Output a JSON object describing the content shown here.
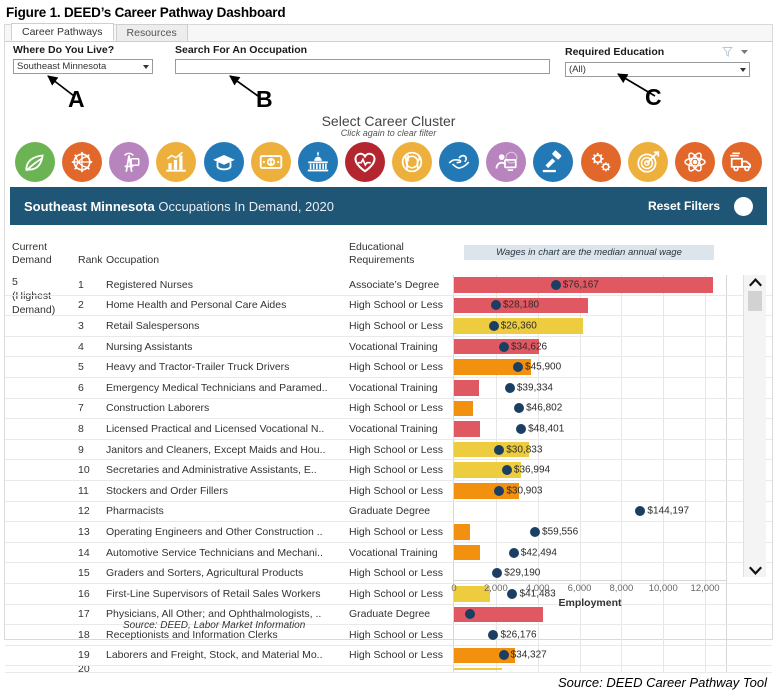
{
  "figure": {
    "caption": "Figure 1. DEED’s Career Pathway Dashboard",
    "bottom_source": "Source: DEED Career Pathway Tool"
  },
  "tabs": [
    {
      "label": "Career Pathways",
      "active": true
    },
    {
      "label": "Resources",
      "active": false
    }
  ],
  "filters": {
    "region": {
      "label": "Where Do You Live?",
      "value": "Southeast Minnesota"
    },
    "search": {
      "label": "Search For An Occupation",
      "value": "",
      "placeholder": ""
    },
    "education": {
      "label": "Required Education",
      "value": "(All)"
    }
  },
  "cluster": {
    "title": "Select Career Cluster",
    "subtitle": "Click again to clear filter",
    "icons": [
      {
        "name": "agriculture-leaf-icon",
        "color": "#6cb353",
        "glyph": "leaf"
      },
      {
        "name": "architecture-gear-icon",
        "color": "#e2672a",
        "glyph": "gear-globe"
      },
      {
        "name": "arts-communications-icon",
        "color": "#b884bd",
        "glyph": "broadcast-tower"
      },
      {
        "name": "business-chart-icon",
        "color": "#eeb03c",
        "glyph": "bar-chart"
      },
      {
        "name": "education-graduation-icon",
        "color": "#2279b5",
        "glyph": "graduation-cap"
      },
      {
        "name": "finance-money-icon",
        "color": "#eeb03c",
        "glyph": "banknote"
      },
      {
        "name": "government-capitol-icon",
        "color": "#2279b5",
        "glyph": "capitol"
      },
      {
        "name": "health-science-heart-icon",
        "color": "#b3262f",
        "glyph": "heart-pulse"
      },
      {
        "name": "hospitality-tourism-icon",
        "color": "#eeb03c",
        "glyph": "plate-utensils"
      },
      {
        "name": "human-services-hands-icon",
        "color": "#2279b5",
        "glyph": "helping-hands"
      },
      {
        "name": "information-technology-icon",
        "color": "#b884bd",
        "glyph": "person-computer"
      },
      {
        "name": "law-public-safety-gavel-icon",
        "color": "#2279b5",
        "glyph": "gavel"
      },
      {
        "name": "manufacturing-gears-icon",
        "color": "#e2672a",
        "glyph": "gears"
      },
      {
        "name": "marketing-target-icon",
        "color": "#eeb03c",
        "glyph": "target-arrow"
      },
      {
        "name": "stem-atom-icon",
        "color": "#e2672a",
        "glyph": "atom"
      },
      {
        "name": "transportation-truck-icon",
        "color": "#e2672a",
        "glyph": "delivery-truck"
      }
    ]
  },
  "banner": {
    "region": "Southeast Minnesota",
    "rest": " Occupations In Demand, 2020",
    "reset_label": "Reset Filters"
  },
  "table": {
    "headers": {
      "demand": "Current Demand",
      "rank": "Rank",
      "occupation": "Occupation",
      "education": "Educational Requirements"
    },
    "wage_note": "Wages in chart are the median annual wage",
    "demand_value": "5",
    "demand_caption_1": "(Highest",
    "demand_caption_2": "Demand)",
    "source_left": "Source: DEED, Labor Market Information"
  },
  "chart_data": {
    "type": "bar",
    "title": "Southeast Minnesota Occupations In Demand, 2020",
    "xlabel": "Employment",
    "ylabel": "",
    "xlim": [
      0,
      13000
    ],
    "grid": true,
    "ticks": [
      0,
      2000,
      4000,
      6000,
      8000,
      10000,
      12000
    ],
    "tick_labels": [
      "0",
      "2,000",
      "4,000",
      "6,000",
      "8,000",
      "10,000",
      "12,000"
    ],
    "dot_series_name": "Median annual wage",
    "dot_color": "#1b3f63",
    "bar_colors": {
      "red": "#e05862",
      "orange": "#f2900f",
      "yellow": "#edcd3f"
    },
    "rows": [
      {
        "rank": "1",
        "occupation": "Registered Nurses",
        "education": "Associate’s Degree",
        "employment": 12400,
        "wage": 76167,
        "wage_label": "$76,167",
        "color": "#e05862"
      },
      {
        "rank": "2",
        "occupation": "Home Health and Personal Care Aides",
        "education": "High School or Less",
        "employment": 6400,
        "wage": 28180,
        "wage_label": "$28,180",
        "color": "#e05862"
      },
      {
        "rank": "3",
        "occupation": "Retail Salespersons",
        "education": "High School or Less",
        "employment": 6150,
        "wage": 26360,
        "wage_label": "$26,360",
        "color": "#edcd3f"
      },
      {
        "rank": "4",
        "occupation": "Nursing Assistants",
        "education": "Vocational Training",
        "employment": 4050,
        "wage": 34626,
        "wage_label": "$34,626",
        "color": "#e05862"
      },
      {
        "rank": "5",
        "occupation": "Heavy and Tractor-Trailer Truck Drivers",
        "education": "High School or Less",
        "employment": 3700,
        "wage": 45900,
        "wage_label": "$45,900",
        "color": "#f2900f"
      },
      {
        "rank": "6",
        "occupation": "Emergency Medical Technicians and Paramed..",
        "education": "Vocational Training",
        "employment": 1200,
        "wage": 39334,
        "wage_label": "$39,334",
        "color": "#e05862"
      },
      {
        "rank": "7",
        "occupation": "Construction Laborers",
        "education": "High School or Less",
        "employment": 900,
        "wage": 46802,
        "wage_label": "$46,802",
        "color": "#f2900f"
      },
      {
        "rank": "8",
        "occupation": "Licensed Practical and Licensed Vocational N..",
        "education": "Vocational Training",
        "employment": 1250,
        "wage": 48401,
        "wage_label": "$48,401",
        "color": "#e05862"
      },
      {
        "rank": "9",
        "occupation": "Janitors and Cleaners, Except Maids and Hou..",
        "education": "High School or Less",
        "employment": 3600,
        "wage": 30833,
        "wage_label": "$30,833",
        "color": "#edcd3f"
      },
      {
        "rank": "10",
        "occupation": "Secretaries and Administrative Assistants, E..",
        "education": "High School or Less",
        "employment": 3200,
        "wage": 36994,
        "wage_label": "$36,994",
        "color": "#edcd3f"
      },
      {
        "rank": "11",
        "occupation": "Stockers and Order Fillers",
        "education": "High School or Less",
        "employment": 3100,
        "wage": 30903,
        "wage_label": "$30,903",
        "color": "#f2900f"
      },
      {
        "rank": "12",
        "occupation": "Pharmacists",
        "education": "Graduate Degree",
        "employment": 0,
        "wage": 144197,
        "wage_label": "$144,197",
        "color": "#f2900f"
      },
      {
        "rank": "13",
        "occupation": "Operating Engineers and Other Construction ..",
        "education": "High School or Less",
        "employment": 750,
        "wage": 59556,
        "wage_label": "$59,556",
        "color": "#f2900f"
      },
      {
        "rank": "14",
        "occupation": "Automotive Service Technicians and Mechani..",
        "education": "Vocational Training",
        "employment": 1250,
        "wage": 42494,
        "wage_label": "$42,494",
        "color": "#f2900f"
      },
      {
        "rank": "15",
        "occupation": "Graders and Sorters, Agricultural Products",
        "education": "High School or Less",
        "employment": 0,
        "wage": 29190,
        "wage_label": "$29,190",
        "color": "#f2900f"
      },
      {
        "rank": "16",
        "occupation": "First-Line Supervisors of Retail Sales Workers",
        "education": "High School or Less",
        "employment": 1700,
        "wage": 41483,
        "wage_label": "$41,483",
        "color": "#edcd3f"
      },
      {
        "rank": "17",
        "occupation": "Physicians, All Other; and Ophthalmologists, ..",
        "education": "Graduate Degree",
        "employment": 4250,
        "wage": 0,
        "wage_label": "",
        "color": "#e05862"
      },
      {
        "rank": "18",
        "occupation": "Receptionists and Information Clerks",
        "education": "High School or Less",
        "employment": 0,
        "wage": 26176,
        "wage_label": "$26,176",
        "color": "#f2900f"
      },
      {
        "rank": "19",
        "occupation": "Laborers and Freight, Stock, and Material Mo..",
        "education": "High School or Less",
        "employment": 2900,
        "wage": 34327,
        "wage_label": "$34,327",
        "color": "#f2900f"
      },
      {
        "rank": "20",
        "occupation": "",
        "education": "",
        "employment": 2300,
        "wage": 0,
        "wage_label": "",
        "color": "#edcd3f"
      }
    ]
  },
  "annotations": [
    {
      "letter": "A",
      "target": "region-filter"
    },
    {
      "letter": "B",
      "target": "search-filter"
    },
    {
      "letter": "C",
      "target": "education-filter"
    }
  ],
  "scrollbar": {
    "up": "˄",
    "down": "˅"
  }
}
